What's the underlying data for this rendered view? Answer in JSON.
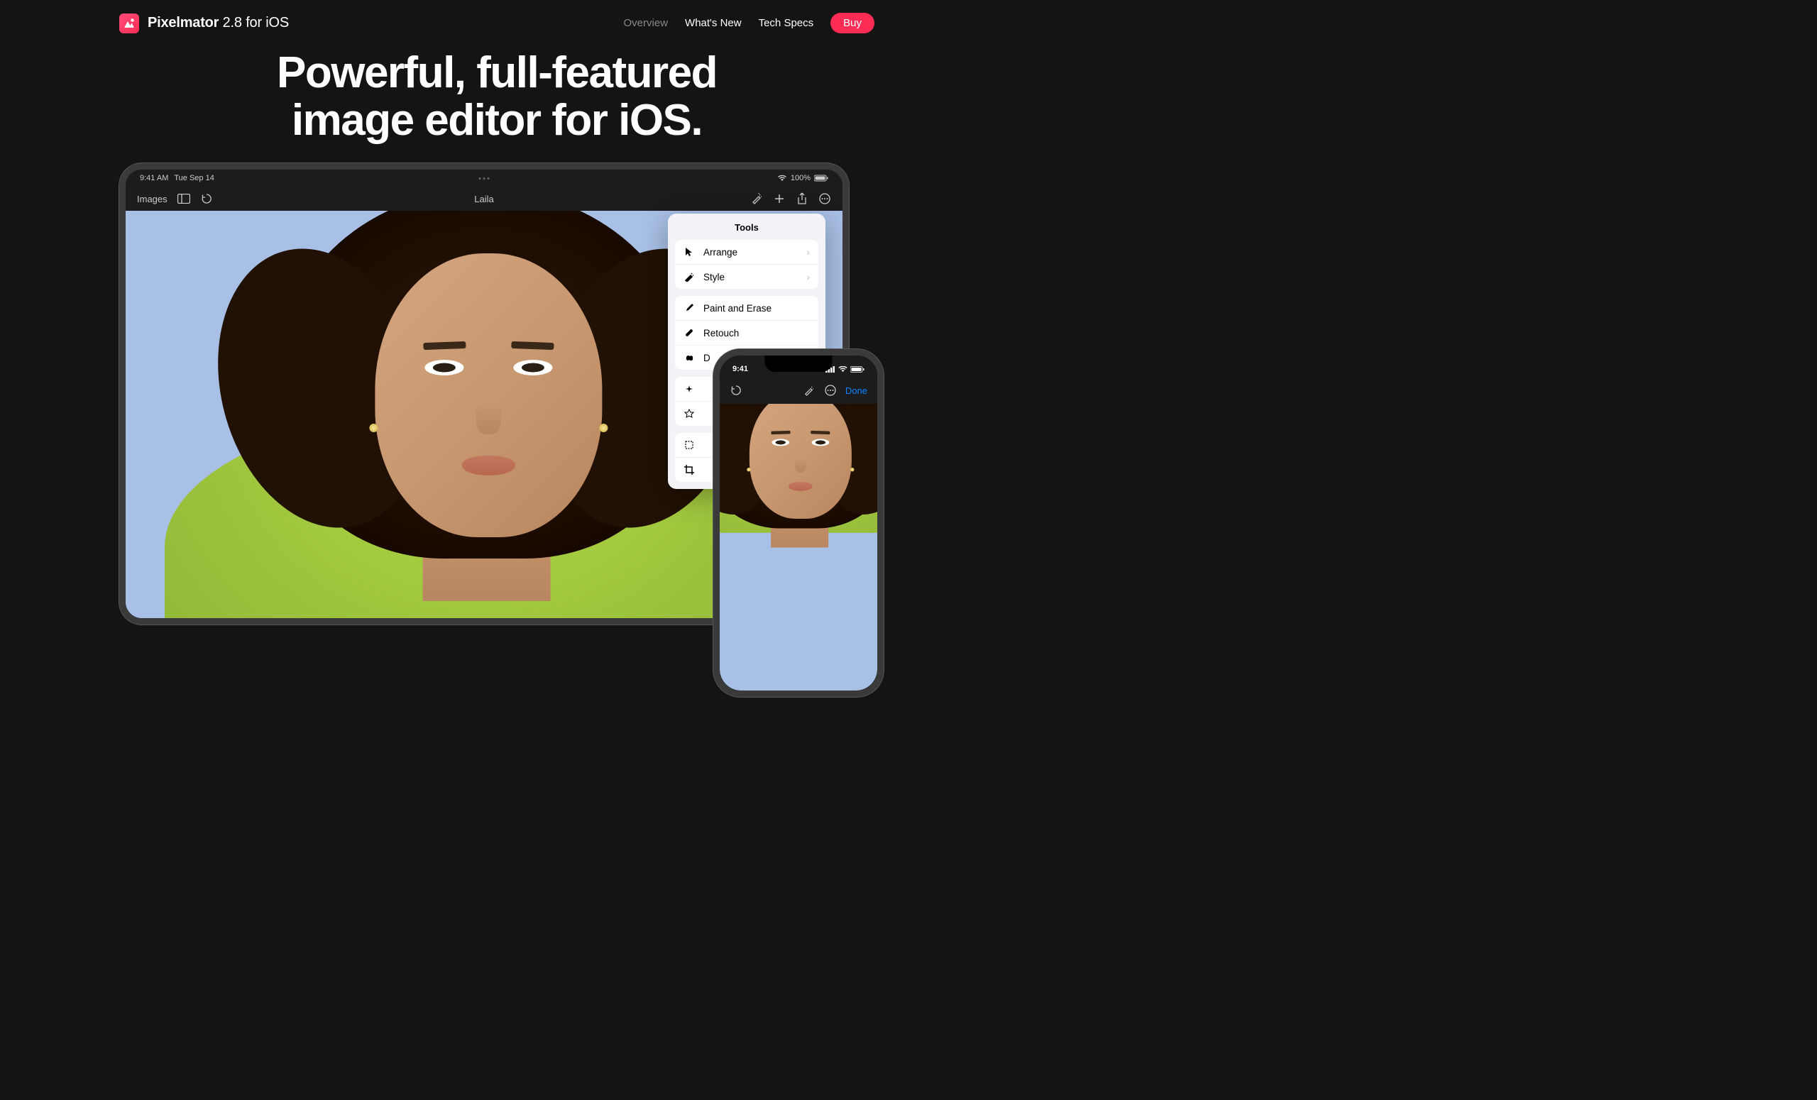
{
  "header": {
    "app_name_bold": "Pixelmator",
    "app_name_rest": " 2.8 for iOS",
    "nav": {
      "overview": "Overview",
      "whats_new": "What's New",
      "tech_specs": "Tech Specs",
      "buy": "Buy"
    }
  },
  "hero": {
    "line1": "Powerful, full-featured",
    "line2": "image editor for iOS."
  },
  "ipad": {
    "status": {
      "time": "9:41 AM",
      "date": "Tue Sep 14",
      "battery": "100%"
    },
    "toolbar": {
      "images_label": "Images",
      "document_title": "Laila"
    },
    "tools_popover": {
      "title": "Tools",
      "groups": [
        {
          "items": [
            {
              "icon": "cursor",
              "label": "Arrange",
              "has_chevron": true
            },
            {
              "icon": "wand",
              "label": "Style",
              "has_chevron": true
            }
          ]
        },
        {
          "items": [
            {
              "icon": "brush",
              "label": "Paint and Erase",
              "has_chevron": false
            },
            {
              "icon": "bandage",
              "label": "Retouch",
              "has_chevron": false
            },
            {
              "icon": "smudge",
              "label": "D",
              "has_chevron": false
            }
          ]
        }
      ]
    }
  },
  "iphone": {
    "status": {
      "time": "9:41"
    },
    "toolbar": {
      "done": "Done"
    }
  }
}
